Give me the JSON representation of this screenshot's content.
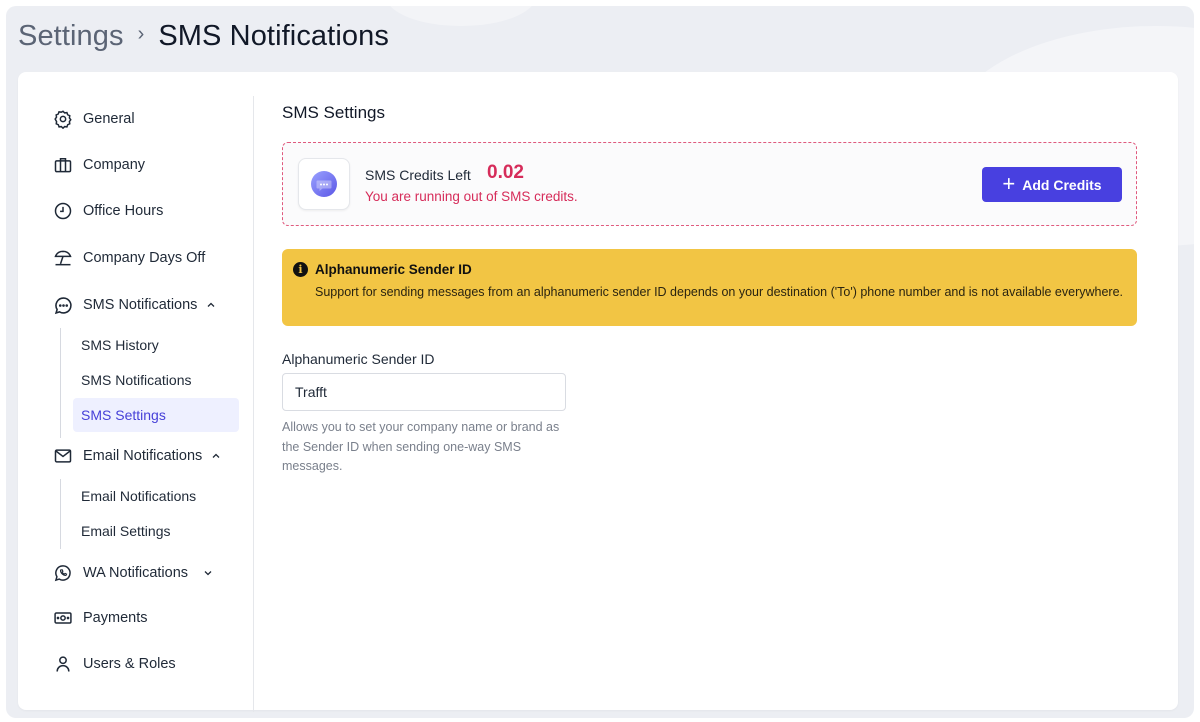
{
  "breadcrumb": {
    "parent": "Settings",
    "separator": "›",
    "current": "SMS Notifications"
  },
  "sidebar": {
    "items": [
      {
        "label": "General",
        "icon": "gear-icon"
      },
      {
        "label": "Company",
        "icon": "briefcase-icon"
      },
      {
        "label": "Office Hours",
        "icon": "clock-icon"
      },
      {
        "label": "Company Days Off",
        "icon": "beach-umbrella-icon"
      },
      {
        "label": "SMS Notifications",
        "icon": "chat-bubble-icon",
        "expanded": true,
        "children": [
          "SMS History",
          "SMS Notifications",
          "SMS Settings"
        ],
        "active_child": "SMS Settings"
      },
      {
        "label": "Email Notifications",
        "icon": "envelope-icon",
        "expanded": true,
        "children": [
          "Email Notifications",
          "Email Settings"
        ]
      },
      {
        "label": "WA Notifications",
        "icon": "whatsapp-icon",
        "expanded": false
      },
      {
        "label": "Payments",
        "icon": "cash-icon"
      },
      {
        "label": "Users & Roles",
        "icon": "user-icon"
      }
    ]
  },
  "main": {
    "title": "SMS Settings",
    "credits": {
      "label": "SMS Credits Left",
      "value": "0.02",
      "warning": "You are running out of SMS credits.",
      "button_label": "Add Credits"
    },
    "alert": {
      "title": "Alphanumeric Sender ID",
      "body": "Support for sending messages from an alphanumeric sender ID depends on your destination ('To') phone number and is not available everywhere."
    },
    "sender_field": {
      "label": "Alphanumeric Sender ID",
      "value": "Trafft",
      "help": "Allows you to set your company name or brand as the Sender ID when sending one-way SMS messages."
    }
  },
  "colors": {
    "accent": "#4840e0",
    "danger": "#d62c5a",
    "warning_bg": "#f2c544",
    "active_bg": "#eef0ff"
  }
}
